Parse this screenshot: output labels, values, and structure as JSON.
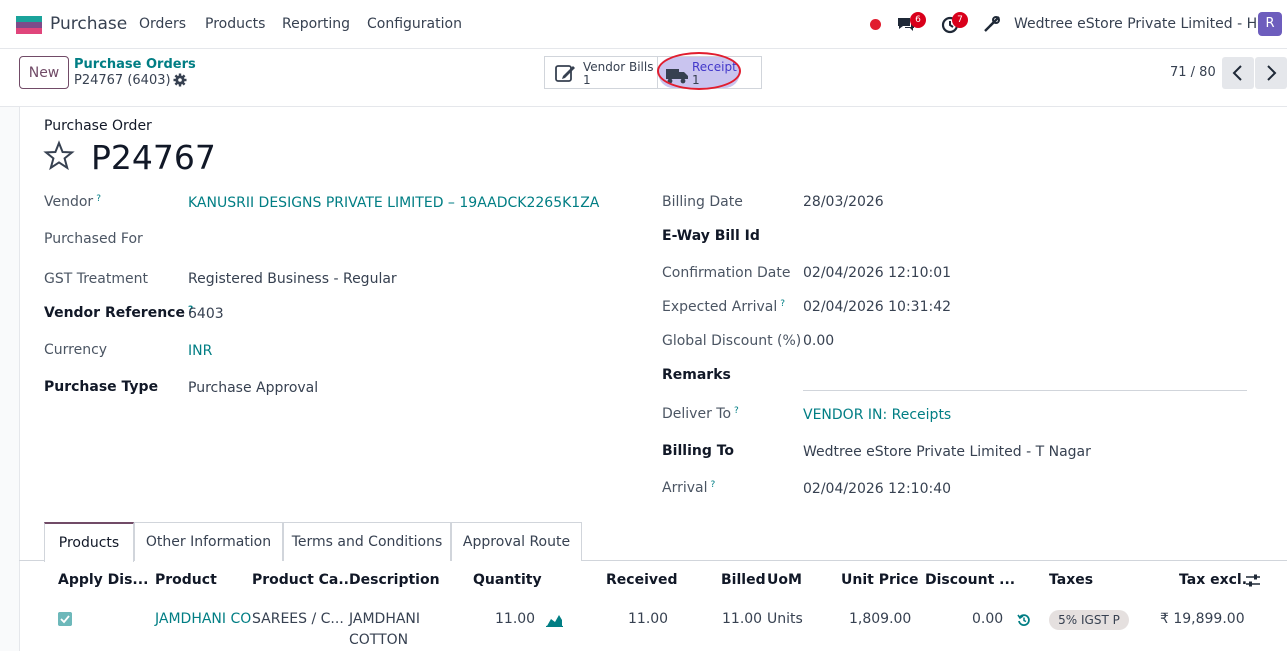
{
  "topbar": {
    "app_name": "Purchase",
    "menus": [
      "Orders",
      "Products",
      "Reporting",
      "Configuration"
    ],
    "chat_badge": "6",
    "activity_badge": "7",
    "company": "Wedtree eStore Private Limited - HO",
    "avatar_letter": "R"
  },
  "control": {
    "new_label": "New",
    "breadcrumb_parent": "Purchase Orders",
    "breadcrumb_current": "P24767 (6403)",
    "smart_buttons": [
      {
        "label": "Vendor Bills",
        "count": "1"
      },
      {
        "label": "Receipt",
        "count": "1"
      }
    ],
    "pager": "71 / 80"
  },
  "form": {
    "caption": "Purchase Order",
    "name": "P24767",
    "left": [
      {
        "label": "Vendor",
        "help": "?",
        "value": "KANUSRII DESIGNS PRIVATE LIMITED – 19AADCK2265K1ZA"
      },
      {
        "label": "Purchased For",
        "value": ""
      },
      {
        "label": "GST Treatment",
        "value": "Registered Business - Regular"
      },
      {
        "label": "Vendor Reference",
        "help": "?",
        "value": "6403"
      },
      {
        "label": "Currency",
        "value": "INR"
      },
      {
        "label": "Purchase Type",
        "value": "Purchase Approval"
      }
    ],
    "right": [
      {
        "label": "Billing Date",
        "value": "28/03/2026"
      },
      {
        "label": "E-Way Bill Id",
        "value": ""
      },
      {
        "label": "Confirmation Date",
        "value": "02/04/2026 12:10:01"
      },
      {
        "label": "Expected Arrival",
        "help": "?",
        "value": "02/04/2026 10:31:42"
      },
      {
        "label": "Global Discount (%)",
        "value": "0.00"
      },
      {
        "label": "Remarks",
        "value": ""
      },
      {
        "label": "Deliver To",
        "help": "?",
        "value": "VENDOR IN: Receipts"
      },
      {
        "label": "Billing To",
        "value": "Wedtree eStore Private Limited - T Nagar"
      },
      {
        "label": "Arrival",
        "help": "?",
        "value": "02/04/2026 12:10:40"
      }
    ]
  },
  "tabs": [
    "Products",
    "Other Information",
    "Terms and Conditions",
    "Approval Route"
  ],
  "table": {
    "columns": [
      "Apply Dis...",
      "Product",
      "Product Ca...",
      "Description",
      "Quantity",
      "Received",
      "Billed",
      "UoM",
      "Unit Price",
      "Discount ...",
      "Taxes",
      "Tax excl."
    ],
    "rows": [
      {
        "product": "JAMDHANI CO",
        "category": "SAREES / C...",
        "description_1": "JAMDHANI",
        "description_2": "COTTON",
        "quantity": "11.00",
        "received": "11.00",
        "billed": "11.00",
        "uom": "Units",
        "unit_price": "1,809.00",
        "discount": "0.00",
        "tax": "5% IGST P",
        "tax_excl": "₹ 19,899.00"
      }
    ]
  },
  "colors": {
    "brand": "#714b67",
    "link": "#017e84",
    "badge": "#d9001b",
    "highlight": "#e11d2e",
    "receipt_fill": "#c9c4ef"
  }
}
